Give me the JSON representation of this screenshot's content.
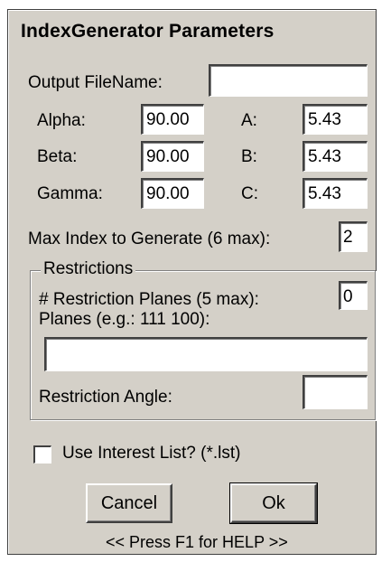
{
  "dialog": {
    "title": "IndexGenerator Parameters",
    "output_filename": {
      "label": "Output FileName:",
      "value": ""
    },
    "alpha": {
      "label": "Alpha:",
      "value": "90.00"
    },
    "beta": {
      "label": "Beta:",
      "value": "90.00"
    },
    "gamma": {
      "label": "Gamma:",
      "value": "90.00"
    },
    "a": {
      "label": "A:",
      "value": "5.43"
    },
    "b": {
      "label": "B:",
      "value": "5.43"
    },
    "c": {
      "label": "C:",
      "value": "5.43"
    },
    "max_index": {
      "label": "Max Index to Generate (6 max):",
      "value": "2"
    },
    "restrictions": {
      "group_label": "Restrictions",
      "num_planes": {
        "label": "# Restriction Planes (5 max):",
        "value": "0"
      },
      "planes": {
        "label": "Planes (e.g.: 111 100):",
        "value": ""
      },
      "angle": {
        "label": "Restriction Angle:",
        "value": ""
      }
    },
    "interest_list": {
      "label": "Use Interest List? (*.lst)",
      "checked": false
    },
    "buttons": {
      "cancel": "Cancel",
      "ok": "Ok"
    },
    "help_text": "<< Press F1 for HELP >>"
  },
  "colors": {
    "dialog_bg": "#d4d0c8",
    "field_bg": "#ffffff",
    "shadow": "#808080"
  }
}
